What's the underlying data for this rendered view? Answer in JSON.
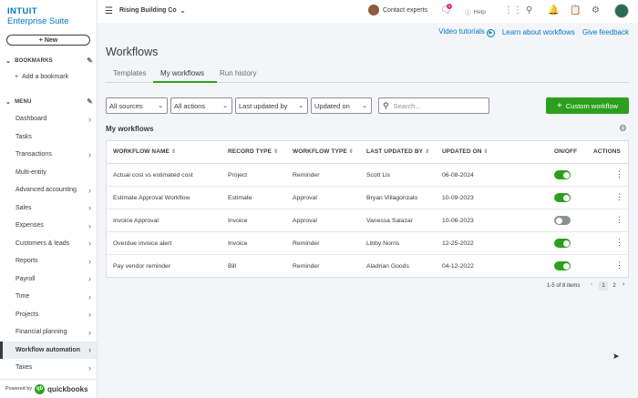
{
  "brand": {
    "line1": "INTUIT",
    "line2": "Enterprise Suite"
  },
  "new_button": "+ New",
  "bookmarks": {
    "heading": "BOOKMARKS",
    "add": "Add a bookmark"
  },
  "menu": {
    "heading": "MENU",
    "items": [
      {
        "label": "Dashboard",
        "has_arrow": true
      },
      {
        "label": "Tasks",
        "has_arrow": false
      },
      {
        "label": "Transactions",
        "has_arrow": true
      },
      {
        "label": "Multi-entity",
        "has_arrow": false
      },
      {
        "label": "Advanced accounting",
        "has_arrow": true
      },
      {
        "label": "Sales",
        "has_arrow": true
      },
      {
        "label": "Expenses",
        "has_arrow": true
      },
      {
        "label": "Customers & leads",
        "has_arrow": true
      },
      {
        "label": "Reports",
        "has_arrow": true
      },
      {
        "label": "Payroll",
        "has_arrow": true
      },
      {
        "label": "Time",
        "has_arrow": true
      },
      {
        "label": "Projects",
        "has_arrow": true
      },
      {
        "label": "Financial planning",
        "has_arrow": true
      },
      {
        "label": "Workflow automation",
        "has_arrow": true,
        "active": true
      },
      {
        "label": "Taxes",
        "has_arrow": true
      }
    ]
  },
  "powered_by": {
    "text": "Powered by",
    "product": "quickbooks"
  },
  "topbar": {
    "company": "Rising Building Co",
    "contact": "Contact experts",
    "help": "Help",
    "notification_count": "3"
  },
  "header": {
    "title": "Workflows",
    "links": [
      "Video tutorials",
      "Learn about workflows",
      "Give feedback"
    ]
  },
  "tabs": [
    "Templates",
    "My workflows",
    "Run history"
  ],
  "active_tab": "My workflows",
  "filters": [
    "All sources",
    "All actions",
    "Last updated by",
    "Updated on"
  ],
  "search_placeholder": "Search...",
  "custom_workflow_button": "Custom workflow",
  "section_label": "My workflows",
  "table": {
    "columns": [
      "WORKFLOW NAME",
      "RECORD TYPE",
      "WORKFLOW TYPE",
      "LAST UPDATED BY",
      "UPDATED ON",
      "ON/OFF",
      "ACTIONS"
    ],
    "rows": [
      {
        "name": "Actual cost vs estimated cost",
        "record": "Project",
        "type": "Reminder",
        "by": "Scott Lis",
        "on": "06-08-2024",
        "enabled": true
      },
      {
        "name": "Estimate Approval Workflow",
        "record": "Estimate",
        "type": "Approval",
        "by": "Bryan Villagonzalo",
        "on": "10-09-2023",
        "enabled": true
      },
      {
        "name": "Invoice Approval",
        "record": "Invoice",
        "type": "Approval",
        "by": "Vanessa Salazar",
        "on": "10-06-2023",
        "enabled": false
      },
      {
        "name": "Overdue invoice alert",
        "record": "Invoice",
        "type": "Reminder",
        "by": "Libby Norris",
        "on": "12-25-2022",
        "enabled": true
      },
      {
        "name": "Pay vendor reminder",
        "record": "Bill",
        "type": "Reminder",
        "by": "Aladrian Goods",
        "on": "04-12-2022",
        "enabled": true
      }
    ]
  },
  "pagination": {
    "summary": "1-5 of 8 items",
    "pages": [
      "1",
      "2"
    ],
    "current": "1"
  },
  "colors": {
    "brand_blue": "#0077c5",
    "accent_green": "#2ca01c",
    "toggle_off": "#8d9096"
  },
  "icons": [
    "menu-icon",
    "chevron-down-icon",
    "chat-icon",
    "help-icon",
    "apps-icon",
    "search-icon",
    "bell-icon",
    "clipboard-icon",
    "gear-icon",
    "pencil-icon",
    "play-icon",
    "kebab-icon"
  ]
}
